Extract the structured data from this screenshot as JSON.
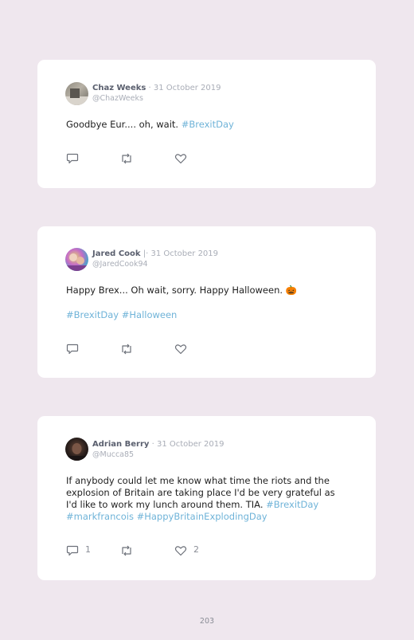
{
  "tweets": [
    {
      "name": "Chaz Weeks",
      "separator": " · ",
      "date": "31 October 2019",
      "handle": "@ChazWeeks",
      "text_plain": "Goodbye Eur.... oh, wait. ",
      "text_tag": "#BrexitDay",
      "reply_count": "",
      "like_count": ""
    },
    {
      "name": "Jared Cook",
      "separator": " |· ",
      "date": "31 October 2019",
      "handle": "@JaredCook94",
      "text_plain": "Happy Brex... Oh wait, sorry. Happy Halloween. 🎃",
      "tags_line": "#BrexitDay #Halloween",
      "reply_count": "",
      "like_count": ""
    },
    {
      "name": "Adrian Berry",
      "separator": " · ",
      "date": "31 October 2019",
      "handle": "@Mucca85",
      "text_plain": "If anybody could let me know what time the riots and the explosion of Britain are taking place I'd be very grateful as I'd like to work my lunch around them. TIA. ",
      "text_tag1": "#BrexitDay",
      "text_tag2": "#markfrancois",
      "text_tag3": "#HappyBritainExplodingDay",
      "reply_count": "1",
      "like_count": "2"
    }
  ],
  "page_number": "203",
  "colors": {
    "background": "#efe7ee",
    "hashtag": "#6fb3d8",
    "card": "#ffffff"
  },
  "icons": [
    "reply-icon",
    "retweet-icon",
    "like-icon"
  ]
}
